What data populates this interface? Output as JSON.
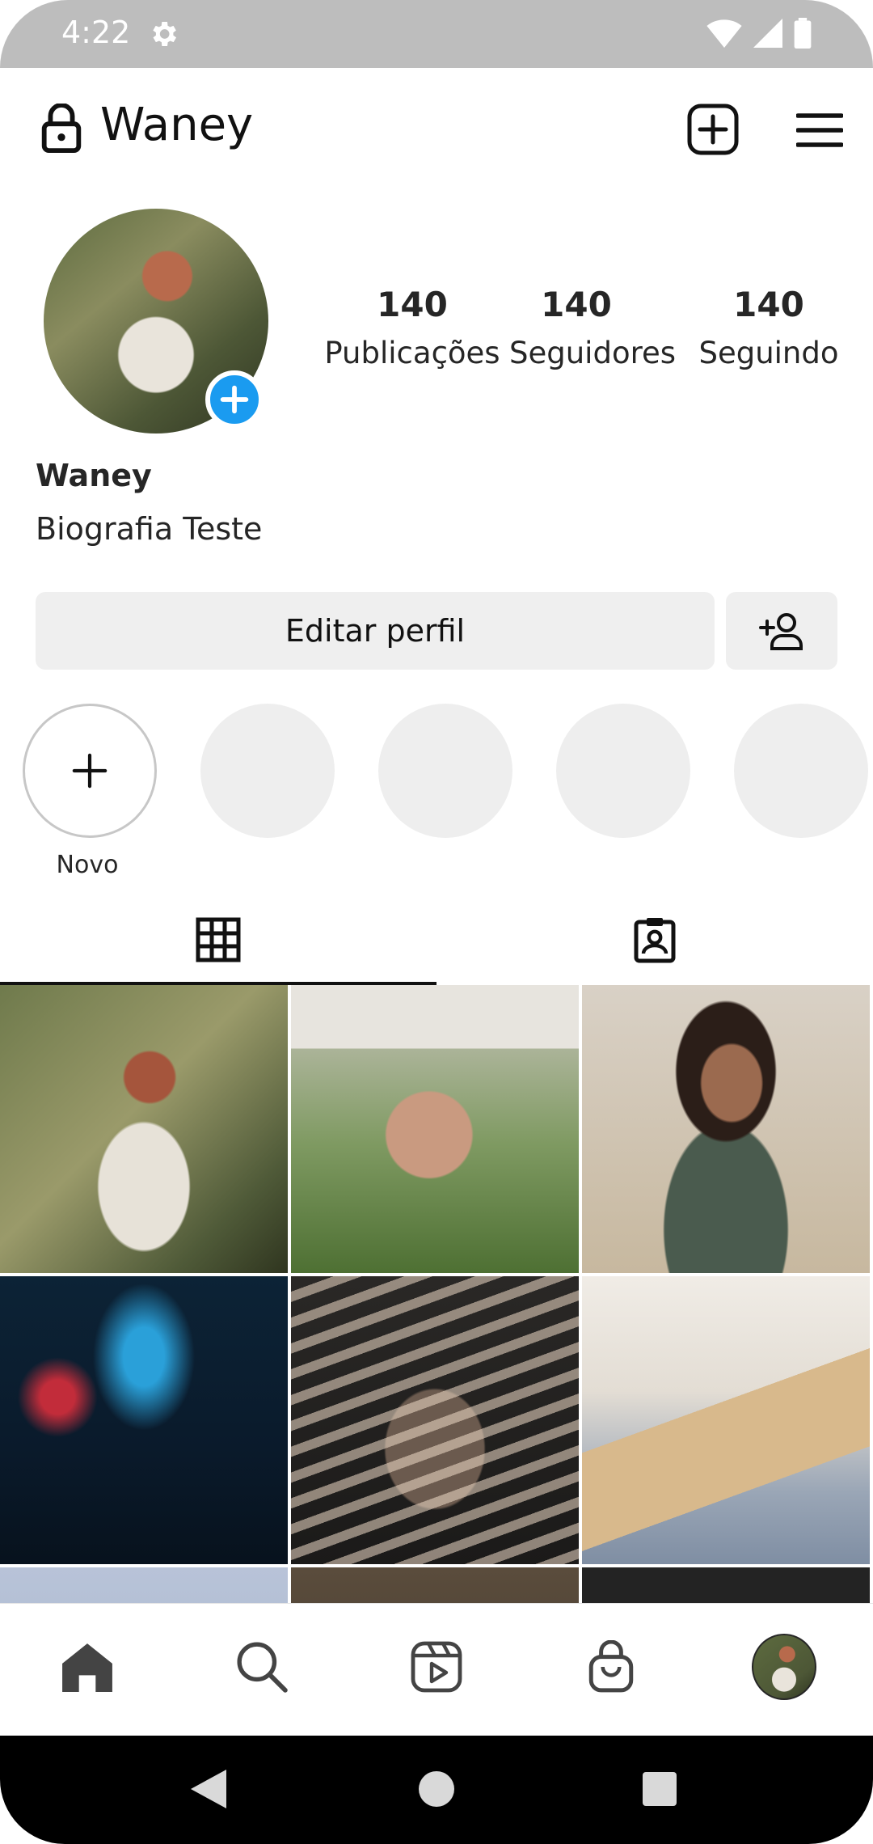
{
  "status_bar": {
    "time": "4:22"
  },
  "header": {
    "username": "Waney"
  },
  "profile": {
    "stats": [
      {
        "value": "140",
        "label": "Publicações"
      },
      {
        "value": "140",
        "label": "Seguidores"
      },
      {
        "value": "140",
        "label": "Seguindo"
      }
    ],
    "name": "Waney",
    "bio": "Biografia Teste",
    "edit_button": "Editar perfil"
  },
  "highlights": {
    "new_label": "Novo"
  },
  "colors": {
    "accent": "#1a9bf0",
    "button_bg": "#efefef",
    "status_bar": "#bdbdbd"
  },
  "icons": {
    "header": [
      "lock-icon",
      "new-post-icon",
      "menu-icon"
    ],
    "tabs": [
      "grid-icon",
      "tagged-icon"
    ],
    "bottom_nav": [
      "home-icon",
      "search-icon",
      "reels-icon",
      "shop-icon",
      "profile-avatar"
    ]
  }
}
